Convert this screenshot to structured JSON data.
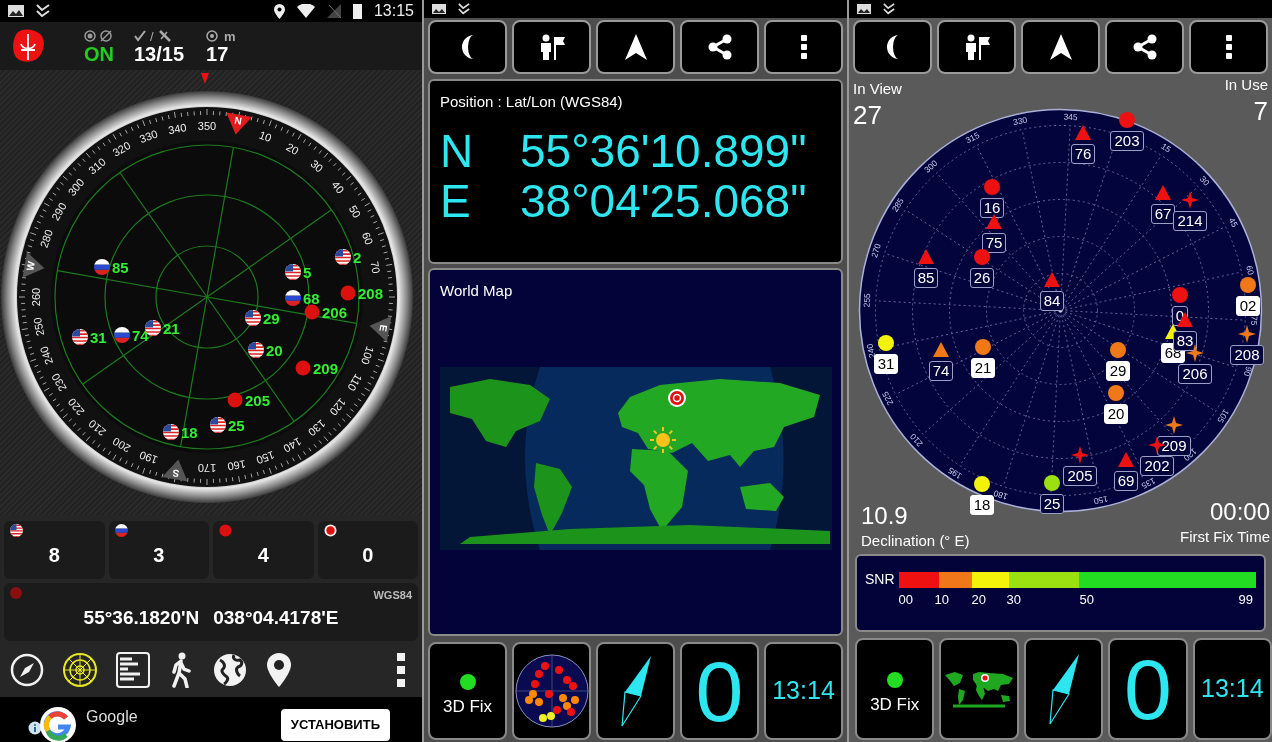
{
  "left": {
    "status_bar": {
      "time": "13:15"
    },
    "header": {
      "gps_on": true,
      "status": "ON",
      "separator": "/",
      "used": "13/15",
      "accuracy_unit": "m",
      "accuracy": "17"
    },
    "dial": {
      "labels": [
        "10",
        "20",
        "30",
        "40",
        "50",
        "60",
        "70",
        "100",
        "110",
        "120",
        "130",
        "140",
        "150",
        "160",
        "170",
        "190",
        "200",
        "210",
        "220",
        "230",
        "240",
        "250",
        "260",
        "280",
        "290",
        "300",
        "310",
        "320",
        "330",
        "340",
        "350"
      ],
      "cardinals": [
        {
          "letter": "N",
          "color": "#e01b1b"
        },
        {
          "letter": "E",
          "color": "#555555"
        },
        {
          "letter": "S",
          "color": "#555555"
        },
        {
          "letter": "W",
          "color": "#555555"
        }
      ]
    },
    "satellites": [
      {
        "label": "85",
        "kind": "ru"
      },
      {
        "label": "2",
        "kind": "us"
      },
      {
        "label": "5",
        "kind": "us"
      },
      {
        "label": "68",
        "kind": "ru"
      },
      {
        "label": "208",
        "kind": "cn"
      },
      {
        "label": "206",
        "kind": "cn"
      },
      {
        "label": "29",
        "kind": "us"
      },
      {
        "label": "31",
        "kind": "us"
      },
      {
        "label": "74",
        "kind": "ru"
      },
      {
        "label": "21",
        "kind": "us"
      },
      {
        "label": "20",
        "kind": "us"
      },
      {
        "label": "209",
        "kind": "cn"
      },
      {
        "label": "205",
        "kind": "cn"
      },
      {
        "label": "18",
        "kind": "us"
      },
      {
        "label": "25",
        "kind": "us"
      }
    ],
    "counts": [
      {
        "kind": "us",
        "count": "8"
      },
      {
        "kind": "ru",
        "count": "3"
      },
      {
        "kind": "cn",
        "count": "4"
      },
      {
        "kind": "other",
        "count": "0"
      }
    ],
    "position": {
      "datum": "WGS84",
      "lat": "55°36.1820'N",
      "lon": "038°04.4178'E"
    },
    "tools": [
      {
        "kind": "compass",
        "selected": false
      },
      {
        "kind": "radar",
        "selected": true
      },
      {
        "kind": "list",
        "selected": false
      },
      {
        "kind": "walk",
        "selected": false
      },
      {
        "kind": "globe",
        "selected": false
      },
      {
        "kind": "pin",
        "selected": false
      },
      {
        "kind": "more",
        "selected": false
      }
    ],
    "ad": {
      "title": "Google",
      "button": "УСТАНОВИТЬ"
    }
  },
  "middle": {
    "toolbar": [
      {
        "kind": "moon"
      },
      {
        "kind": "person-flag"
      },
      {
        "kind": "arrow"
      },
      {
        "kind": "share"
      },
      {
        "kind": "more"
      }
    ],
    "position": {
      "title": "Position : Lat/Lon (WGS84)",
      "rows": [
        {
          "axis": "N",
          "value": "55°36'10.899\""
        },
        {
          "axis": "E",
          "value": "38°04'25.068\""
        }
      ]
    },
    "world_map": {
      "title": "World Map"
    },
    "tiles": [
      {
        "kind": "fix",
        "fix": true,
        "label": "3D Fix"
      },
      {
        "kind": "skyplot"
      },
      {
        "kind": "compass"
      },
      {
        "kind": "count",
        "value": "0"
      },
      {
        "kind": "time",
        "value": "13:14"
      }
    ]
  },
  "right": {
    "toolbar": [
      {
        "kind": "moon"
      },
      {
        "kind": "person-flag"
      },
      {
        "kind": "arrow"
      },
      {
        "kind": "share"
      },
      {
        "kind": "more"
      }
    ],
    "in_view": {
      "label": "In View",
      "value": "27"
    },
    "in_use": {
      "label": "In Use",
      "value": "7"
    },
    "sky_plot": {
      "degree_labels": [
        "345",
        "330",
        "315",
        "300",
        "285",
        "270",
        "255",
        "240",
        "225",
        "210",
        "195",
        "180",
        "150",
        "135",
        "120",
        "105",
        "90",
        "75",
        "60",
        "45",
        "30",
        "15"
      ],
      "satellites": [
        {
          "label": "76",
          "kind": "triangle",
          "color": "#ee1111",
          "used": false
        },
        {
          "label": "203",
          "kind": "circle",
          "color": "#ee1111",
          "used": false
        },
        {
          "label": "16",
          "kind": "circle",
          "color": "#ee1111",
          "used": false
        },
        {
          "label": "75",
          "kind": "triangle",
          "color": "#ee1111",
          "used": false
        },
        {
          "label": "67",
          "kind": "triangle",
          "color": "#ee1111",
          "used": false
        },
        {
          "label": "214",
          "kind": "star",
          "color": "#ee1111",
          "used": false
        },
        {
          "label": "85",
          "kind": "triangle",
          "color": "#ee1111",
          "used": false
        },
        {
          "label": "26",
          "kind": "circle",
          "color": "#ee1111",
          "used": false
        },
        {
          "label": "84",
          "kind": "triangle",
          "color": "#ee1111",
          "used": false
        },
        {
          "label": "0",
          "kind": "circle",
          "color": "#ee1111",
          "used": false
        },
        {
          "label": "02",
          "kind": "circle",
          "color": "#f07818",
          "used": true
        },
        {
          "label": "68",
          "kind": "triangle",
          "color": "#f2f20a",
          "used": true
        },
        {
          "label": "83",
          "kind": "triangle",
          "color": "#ee1111",
          "used": false
        },
        {
          "label": "208",
          "kind": "star",
          "color": "#f07818",
          "used": false
        },
        {
          "label": "206",
          "kind": "star",
          "color": "#f07818",
          "used": false
        },
        {
          "label": "31",
          "kind": "circle",
          "color": "#f2f20a",
          "used": true
        },
        {
          "label": "74",
          "kind": "triangle",
          "color": "#f07818",
          "used": false
        },
        {
          "label": "21",
          "kind": "circle",
          "color": "#f07818",
          "used": true
        },
        {
          "label": "29",
          "kind": "circle",
          "color": "#f07818",
          "used": true
        },
        {
          "label": "20",
          "kind": "circle",
          "color": "#f07818",
          "used": true
        },
        {
          "label": "209",
          "kind": "star",
          "color": "#f07818",
          "used": false
        },
        {
          "label": "202",
          "kind": "star",
          "color": "#ee1111",
          "used": false
        },
        {
          "label": "205",
          "kind": "star",
          "color": "#ee1111",
          "used": false
        },
        {
          "label": "69",
          "kind": "triangle",
          "color": "#ee1111",
          "used": false
        },
        {
          "label": "18",
          "kind": "circle",
          "color": "#f2f20a",
          "used": true
        },
        {
          "label": "25",
          "kind": "circle",
          "color": "#9be010",
          "used": false
        }
      ]
    },
    "declination": {
      "value": "10.9",
      "label": "Declination (° E)"
    },
    "first_fix": {
      "value": "00:00",
      "label": "First Fix Time"
    },
    "snr": {
      "label": "SNR",
      "segments": [
        {
          "color": "#ee1111"
        },
        {
          "color": "#f07818"
        },
        {
          "color": "#f2f20a"
        },
        {
          "color": "#9be010"
        },
        {
          "color": "#22dd22"
        }
      ],
      "ticks": [
        "00",
        "10",
        "20",
        "30",
        "50",
        "99"
      ]
    },
    "tiles": [
      {
        "kind": "fix",
        "fix": true,
        "label": "3D Fix"
      },
      {
        "kind": "worldmap"
      },
      {
        "kind": "compass"
      },
      {
        "kind": "count",
        "value": "0"
      },
      {
        "kind": "time",
        "value": "13:14"
      }
    ]
  }
}
